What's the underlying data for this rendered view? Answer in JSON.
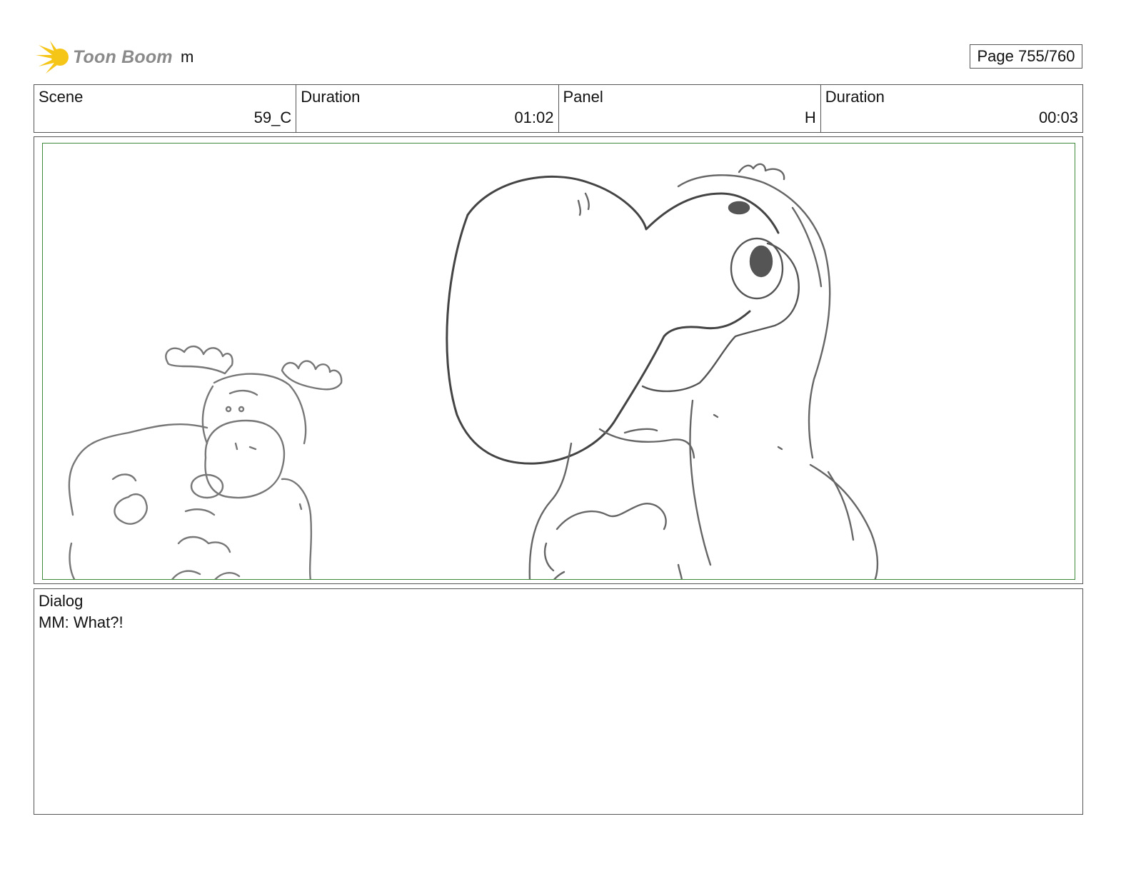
{
  "header": {
    "logo_text": "Toon Boom",
    "project_title": "m",
    "page_indicator": "Page 755/760"
  },
  "info": {
    "scene_label": "Scene",
    "scene_value": "59_C",
    "scene_duration_label": "Duration",
    "scene_duration_value": "01:02",
    "panel_label": "Panel",
    "panel_value": "H",
    "panel_duration_label": "Duration",
    "panel_duration_value": "00:03"
  },
  "dialog": {
    "label": "Dialog",
    "text": "MM: What?!"
  },
  "colors": {
    "logo_star": "#f5c518",
    "safe_frame": "#3f8a3a",
    "sketch_line": "#666666"
  }
}
